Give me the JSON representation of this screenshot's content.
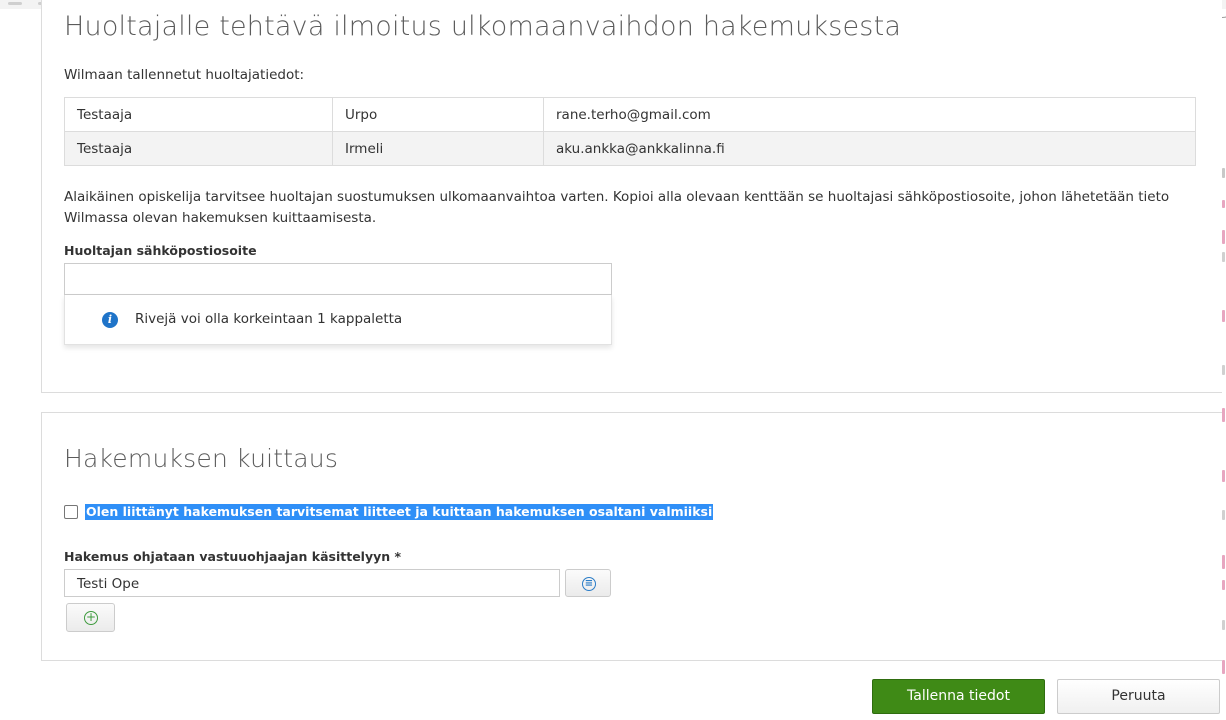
{
  "notice_section": {
    "title": "Huoltajalle tehtävä ilmoitus ulkomaanvaihdon hakemuksesta",
    "saved_guardians_label": "Wilmaan tallennetut huoltajatiedot:",
    "guardians": [
      {
        "last_name": "Testaaja",
        "first_name": "Urpo",
        "email": "rane.terho@gmail.com"
      },
      {
        "last_name": "Testaaja",
        "first_name": "Irmeli",
        "email": "aku.ankka@ankkalinna.fi"
      }
    ],
    "instructions": "Alaikäinen opiskelija tarvitsee huoltajan suostumuksen ulkomaanvaihtoa varten. Kopioi alla olevaan kenttään se huoltajasi sähköpostiosoite, johon lähetetään tieto Wilmassa olevan hakemuksen kuittaamisesta.",
    "email_field_label": "Huoltajan sähköpostiosoite",
    "email_field_value": "",
    "info_message": "Rivejä voi olla korkeintaan 1 kappaletta",
    "info_icon": "info-circle-icon"
  },
  "acknowledgement_section": {
    "title": "Hakemuksen kuittaus",
    "checkbox_label": "Olen liittänyt hakemuksen tarvitsemat liitteet ja kuittaan hakemuksen osaltani valmiiksi",
    "checkbox_checked": false,
    "advisor_label": "Hakemus ohjataan vastuuohjaajan käsittelyyn *",
    "advisor_value": "Testi Ope",
    "select_icon": "list-circle-icon",
    "add_icon": "plus-circle-icon"
  },
  "actions": {
    "save_label": "Tallenna tiedot",
    "cancel_label": "Peruuta"
  },
  "colors": {
    "primary_button": "#3f8a16",
    "highlight": "#2f8ff7",
    "info_icon": "#1f74c9",
    "table_alt_row": "#f3f3f3"
  }
}
